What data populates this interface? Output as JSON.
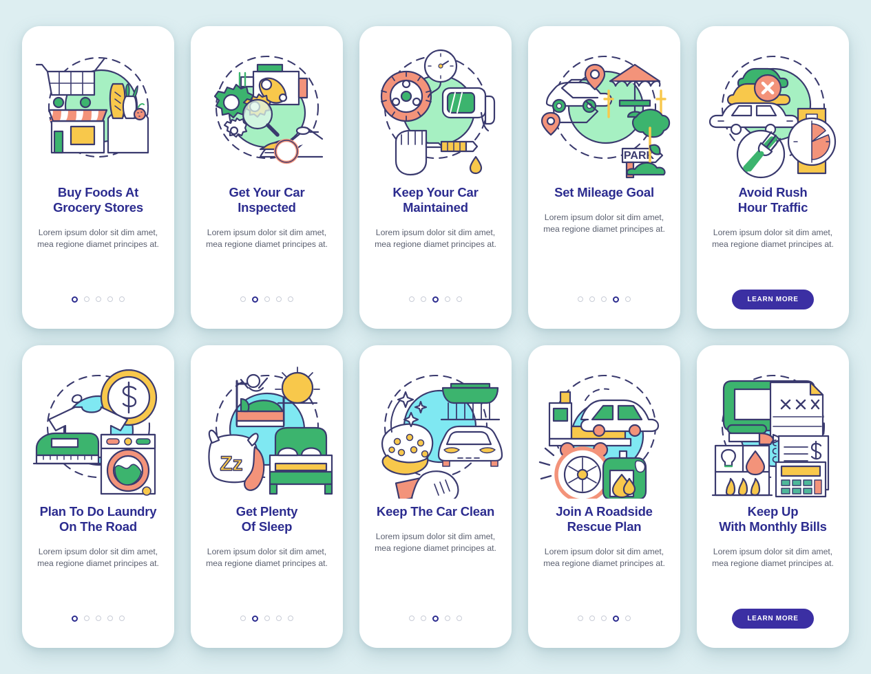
{
  "theme": {
    "page_background": "#ddeef1",
    "card_background": "#ffffff",
    "title_color": "#2c2c8f",
    "body_color": "#5b6070",
    "dot_active_color": "#2c2c8f",
    "dot_inactive_color": "#c8ccd6",
    "button_color": "#3b2fa3",
    "button_text_color": "#ffffff",
    "illustration_stroke": "#3a3a6e",
    "blob_green": "#a6f0c2",
    "blob_cyan": "#7fe8f2",
    "accent_green": "#3cb46e",
    "accent_coral": "#f3937a",
    "accent_yellow": "#f8c84b",
    "accent_teal": "#4fb89a"
  },
  "cards": [
    {
      "id": "buy-foods-at-grocery-stores",
      "title": "Buy Foods At\nGrocery Stores",
      "body": "Lorem ipsum dolor sit dim amet, mea regione diamet principes at.",
      "illustration": "grocery-shopping-illustration",
      "blob": "green",
      "dots": {
        "count": 5,
        "active_index": 0
      },
      "button": null
    },
    {
      "id": "get-your-car-inspected",
      "title": "Get Your Car\nInspected",
      "body": "Lorem ipsum dolor sit dim amet, mea regione diamet principes at.",
      "illustration": "car-inspection-illustration",
      "blob": "green",
      "dots": {
        "count": 5,
        "active_index": 1
      },
      "button": null
    },
    {
      "id": "keep-your-car-maintained",
      "title": "Keep Your Car\nMaintained",
      "body": "Lorem ipsum dolor sit dim amet, mea regione diamet principes at.",
      "illustration": "car-maintenance-illustration",
      "blob": "green",
      "dots": {
        "count": 5,
        "active_index": 2
      },
      "button": null
    },
    {
      "id": "set-mileage-goal",
      "title": "Set Mileage Goal",
      "body": "Lorem ipsum dolor sit dim amet, mea regione diamet principes at.",
      "illustration": "mileage-route-park-illustration",
      "illustration_text": "PARK",
      "blob": "green",
      "dots": {
        "count": 5,
        "active_index": 3
      },
      "button": null
    },
    {
      "id": "avoid-rush-hour-traffic",
      "title": "Avoid Rush\nHour Traffic",
      "body": "Lorem ipsum dolor sit dim amet, mea regione diamet principes at.",
      "illustration": "rush-hour-traffic-illustration",
      "blob": "green",
      "dots": null,
      "button": "LEARN MORE"
    },
    {
      "id": "plan-to-do-laundry-on-the-road",
      "title": "Plan To Do Laundry\nOn The Road",
      "body": "Lorem ipsum dolor sit dim amet, mea regione diamet principes at.",
      "illustration": "laundry-cost-illustration",
      "blob": "cyan",
      "dots": {
        "count": 5,
        "active_index": 0
      },
      "button": null
    },
    {
      "id": "get-plenty-of-sleep",
      "title": "Get Plenty\nOf Sleep",
      "body": "Lorem ipsum dolor sit dim amet, mea regione diamet principes at.",
      "illustration": "sleep-bed-illustration",
      "illustration_text": "Zz",
      "blob": "cyan",
      "dots": {
        "count": 5,
        "active_index": 1
      },
      "button": null
    },
    {
      "id": "keep-the-car-clean",
      "title": "Keep The Car Clean",
      "body": "Lorem ipsum dolor sit dim amet, mea regione diamet principes at.",
      "illustration": "car-wash-illustration",
      "blob": "cyan",
      "dots": {
        "count": 5,
        "active_index": 2
      },
      "button": null
    },
    {
      "id": "join-a-roadside-rescue-plan",
      "title": "Join A Roadside\nRescue Plan",
      "body": "Lorem ipsum dolor sit dim amet, mea regione diamet principes at.",
      "illustration": "roadside-rescue-illustration",
      "blob": "cyan",
      "dots": {
        "count": 5,
        "active_index": 3
      },
      "button": null
    },
    {
      "id": "keep-up-with-monthly-bills",
      "title": "Keep Up\nWith Monthly Bills",
      "body": "Lorem ipsum dolor sit dim amet, mea regione diamet principes at.",
      "illustration": "monthly-bills-illustration",
      "illustration_text": "× × ×",
      "blob": "cyan",
      "dots": null,
      "button": "LEARN MORE"
    }
  ]
}
